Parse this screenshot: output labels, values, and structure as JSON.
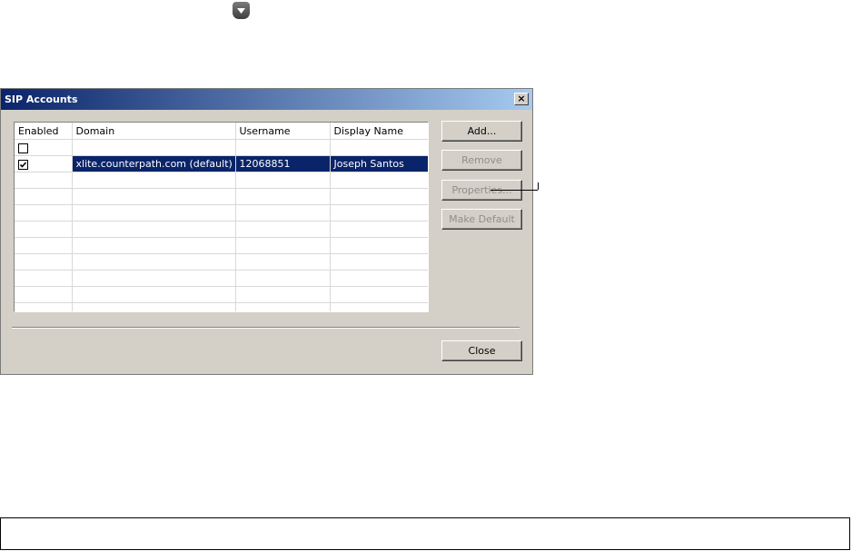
{
  "dialog": {
    "title": "SIP Accounts",
    "close_glyph": "×"
  },
  "table": {
    "headers": [
      "Enabled",
      "Domain",
      "Username",
      "Display Name"
    ],
    "rows": [
      {
        "enabled": false,
        "domain": "",
        "username": "",
        "display_name": ""
      },
      {
        "enabled": true,
        "domain": "xlite.counterpath.com (default)",
        "username": "12068851",
        "display_name": "Joseph Santos",
        "selected": true
      }
    ]
  },
  "buttons": {
    "add": "Add...",
    "remove": "Remove",
    "properties": "Properties...",
    "make_default": "Make Default",
    "close": "Close"
  },
  "colors": {
    "selection": "#0a246a",
    "dialog_bg": "#d4d0c8",
    "titlebar_start": "#0a246a",
    "titlebar_end": "#a6caf0"
  },
  "icons": {
    "top": "dropdown-arrow-icon",
    "checkbox_checked": "checkmark-icon"
  }
}
